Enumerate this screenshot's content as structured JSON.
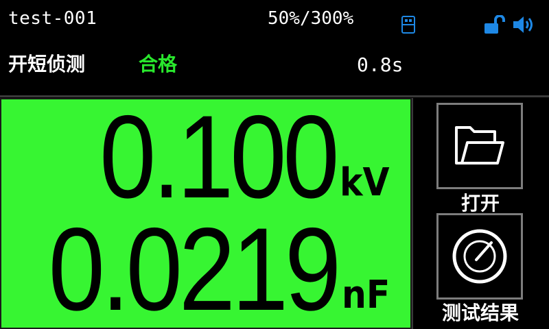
{
  "header": {
    "file_name": "test-001",
    "load_ratio": "50%/300%",
    "icons": [
      "usb-icon",
      "unlocked-padlock-icon",
      "speaker-icon"
    ],
    "icon_color": "#1e88e5"
  },
  "status": {
    "mode": "开短侦测",
    "result": "合格",
    "result_color": "#29e82d",
    "elapsed": "0.8s"
  },
  "measurement": {
    "background_color": "#37f532",
    "voltage": {
      "value": "0.100",
      "unit": "kV"
    },
    "capacitance": {
      "value": "0.0219",
      "unit": "nF"
    }
  },
  "side_buttons": {
    "open": {
      "label": "打开",
      "icon": "folder-icon"
    },
    "result": {
      "label": "测试结果",
      "icon": "gauge-icon"
    }
  }
}
